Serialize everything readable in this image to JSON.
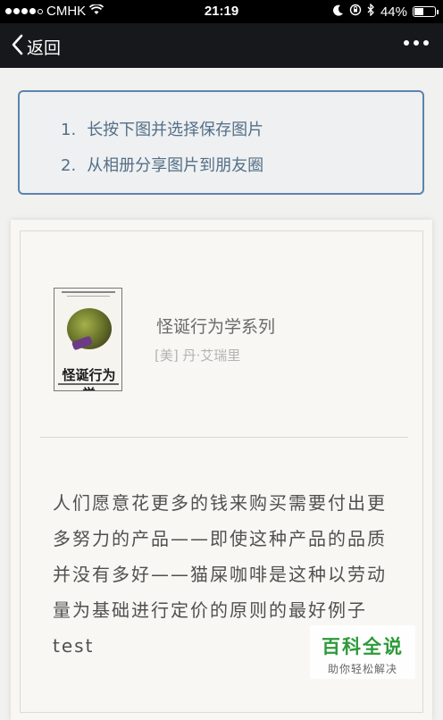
{
  "status_bar": {
    "carrier": "CMHK",
    "time": "21:19",
    "battery": "44%",
    "battery_level": 0.44,
    "signal_bars": 4
  },
  "nav": {
    "back_label": "返回"
  },
  "instructions": {
    "items": [
      {
        "num": "1.",
        "text": "长按下图并选择保存图片"
      },
      {
        "num": "2.",
        "text": "从相册分享图片到朋友圈"
      }
    ]
  },
  "book": {
    "cover_title": "怪诞行为学",
    "title": "怪诞行为学系列",
    "author": "[美] 丹·艾瑞里"
  },
  "quote": {
    "lines": [
      "人们愿意花更多的钱来购买需要付出更",
      "多努力的产品——即使这种产品的品质",
      "并没有多好——猫屎咖啡是这种以劳动",
      "量为基础进行定价的原则的最好例子"
    ],
    "extra": "test"
  },
  "watermark": {
    "title": "百科全说",
    "subtitle": "助你轻松解决"
  },
  "colors": {
    "nav_bg": "#17181b",
    "instruction_border": "#5d84ad",
    "instruction_text": "#546f88",
    "watermark_green": "#2e9a3a"
  }
}
